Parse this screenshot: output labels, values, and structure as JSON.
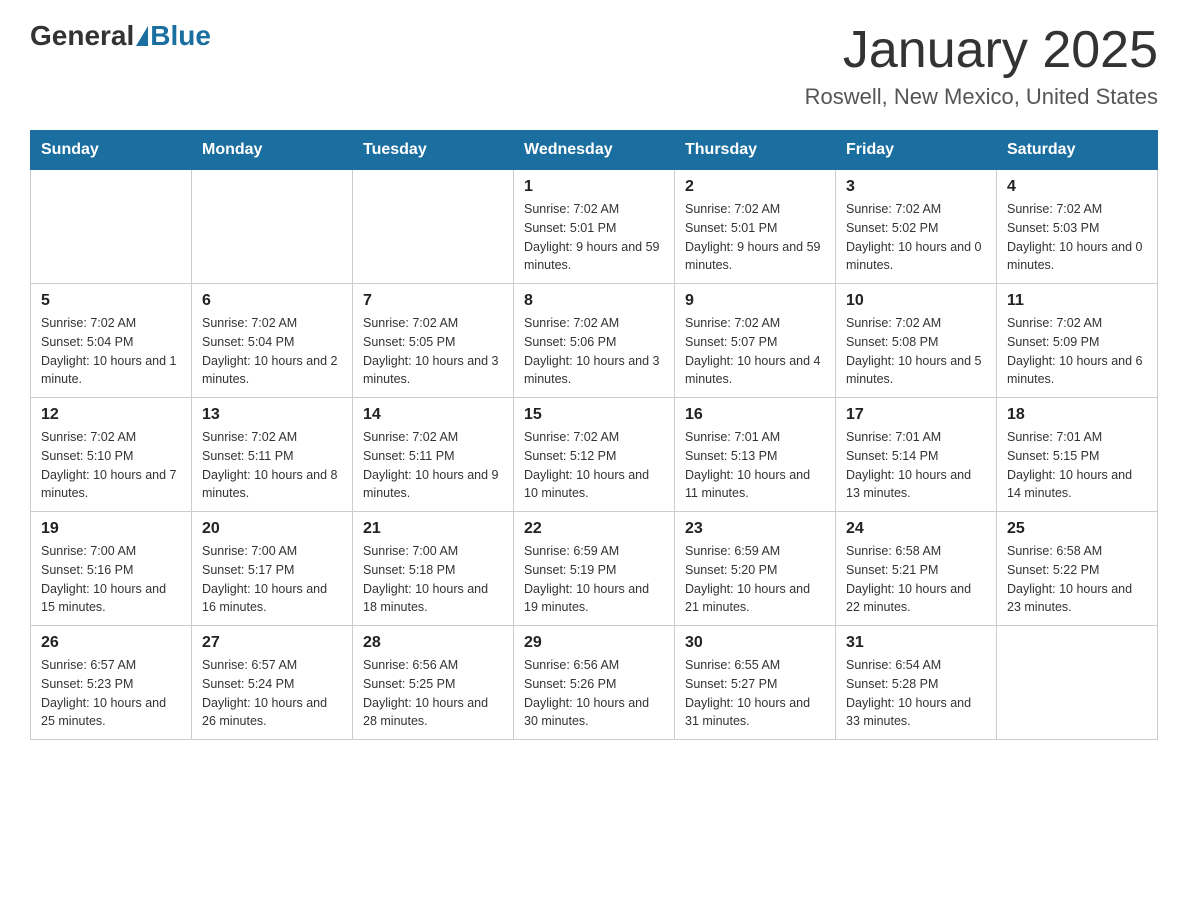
{
  "header": {
    "logo": {
      "general": "General",
      "blue": "Blue"
    },
    "title": "January 2025",
    "subtitle": "Roswell, New Mexico, United States"
  },
  "calendar": {
    "days_of_week": [
      "Sunday",
      "Monday",
      "Tuesday",
      "Wednesday",
      "Thursday",
      "Friday",
      "Saturday"
    ],
    "weeks": [
      [
        {
          "day": "",
          "info": ""
        },
        {
          "day": "",
          "info": ""
        },
        {
          "day": "",
          "info": ""
        },
        {
          "day": "1",
          "info": "Sunrise: 7:02 AM\nSunset: 5:01 PM\nDaylight: 9 hours\nand 59 minutes."
        },
        {
          "day": "2",
          "info": "Sunrise: 7:02 AM\nSunset: 5:01 PM\nDaylight: 9 hours\nand 59 minutes."
        },
        {
          "day": "3",
          "info": "Sunrise: 7:02 AM\nSunset: 5:02 PM\nDaylight: 10 hours\nand 0 minutes."
        },
        {
          "day": "4",
          "info": "Sunrise: 7:02 AM\nSunset: 5:03 PM\nDaylight: 10 hours\nand 0 minutes."
        }
      ],
      [
        {
          "day": "5",
          "info": "Sunrise: 7:02 AM\nSunset: 5:04 PM\nDaylight: 10 hours\nand 1 minute."
        },
        {
          "day": "6",
          "info": "Sunrise: 7:02 AM\nSunset: 5:04 PM\nDaylight: 10 hours\nand 2 minutes."
        },
        {
          "day": "7",
          "info": "Sunrise: 7:02 AM\nSunset: 5:05 PM\nDaylight: 10 hours\nand 3 minutes."
        },
        {
          "day": "8",
          "info": "Sunrise: 7:02 AM\nSunset: 5:06 PM\nDaylight: 10 hours\nand 3 minutes."
        },
        {
          "day": "9",
          "info": "Sunrise: 7:02 AM\nSunset: 5:07 PM\nDaylight: 10 hours\nand 4 minutes."
        },
        {
          "day": "10",
          "info": "Sunrise: 7:02 AM\nSunset: 5:08 PM\nDaylight: 10 hours\nand 5 minutes."
        },
        {
          "day": "11",
          "info": "Sunrise: 7:02 AM\nSunset: 5:09 PM\nDaylight: 10 hours\nand 6 minutes."
        }
      ],
      [
        {
          "day": "12",
          "info": "Sunrise: 7:02 AM\nSunset: 5:10 PM\nDaylight: 10 hours\nand 7 minutes."
        },
        {
          "day": "13",
          "info": "Sunrise: 7:02 AM\nSunset: 5:11 PM\nDaylight: 10 hours\nand 8 minutes."
        },
        {
          "day": "14",
          "info": "Sunrise: 7:02 AM\nSunset: 5:11 PM\nDaylight: 10 hours\nand 9 minutes."
        },
        {
          "day": "15",
          "info": "Sunrise: 7:02 AM\nSunset: 5:12 PM\nDaylight: 10 hours\nand 10 minutes."
        },
        {
          "day": "16",
          "info": "Sunrise: 7:01 AM\nSunset: 5:13 PM\nDaylight: 10 hours\nand 11 minutes."
        },
        {
          "day": "17",
          "info": "Sunrise: 7:01 AM\nSunset: 5:14 PM\nDaylight: 10 hours\nand 13 minutes."
        },
        {
          "day": "18",
          "info": "Sunrise: 7:01 AM\nSunset: 5:15 PM\nDaylight: 10 hours\nand 14 minutes."
        }
      ],
      [
        {
          "day": "19",
          "info": "Sunrise: 7:00 AM\nSunset: 5:16 PM\nDaylight: 10 hours\nand 15 minutes."
        },
        {
          "day": "20",
          "info": "Sunrise: 7:00 AM\nSunset: 5:17 PM\nDaylight: 10 hours\nand 16 minutes."
        },
        {
          "day": "21",
          "info": "Sunrise: 7:00 AM\nSunset: 5:18 PM\nDaylight: 10 hours\nand 18 minutes."
        },
        {
          "day": "22",
          "info": "Sunrise: 6:59 AM\nSunset: 5:19 PM\nDaylight: 10 hours\nand 19 minutes."
        },
        {
          "day": "23",
          "info": "Sunrise: 6:59 AM\nSunset: 5:20 PM\nDaylight: 10 hours\nand 21 minutes."
        },
        {
          "day": "24",
          "info": "Sunrise: 6:58 AM\nSunset: 5:21 PM\nDaylight: 10 hours\nand 22 minutes."
        },
        {
          "day": "25",
          "info": "Sunrise: 6:58 AM\nSunset: 5:22 PM\nDaylight: 10 hours\nand 23 minutes."
        }
      ],
      [
        {
          "day": "26",
          "info": "Sunrise: 6:57 AM\nSunset: 5:23 PM\nDaylight: 10 hours\nand 25 minutes."
        },
        {
          "day": "27",
          "info": "Sunrise: 6:57 AM\nSunset: 5:24 PM\nDaylight: 10 hours\nand 26 minutes."
        },
        {
          "day": "28",
          "info": "Sunrise: 6:56 AM\nSunset: 5:25 PM\nDaylight: 10 hours\nand 28 minutes."
        },
        {
          "day": "29",
          "info": "Sunrise: 6:56 AM\nSunset: 5:26 PM\nDaylight: 10 hours\nand 30 minutes."
        },
        {
          "day": "30",
          "info": "Sunrise: 6:55 AM\nSunset: 5:27 PM\nDaylight: 10 hours\nand 31 minutes."
        },
        {
          "day": "31",
          "info": "Sunrise: 6:54 AM\nSunset: 5:28 PM\nDaylight: 10 hours\nand 33 minutes."
        },
        {
          "day": "",
          "info": ""
        }
      ]
    ]
  }
}
